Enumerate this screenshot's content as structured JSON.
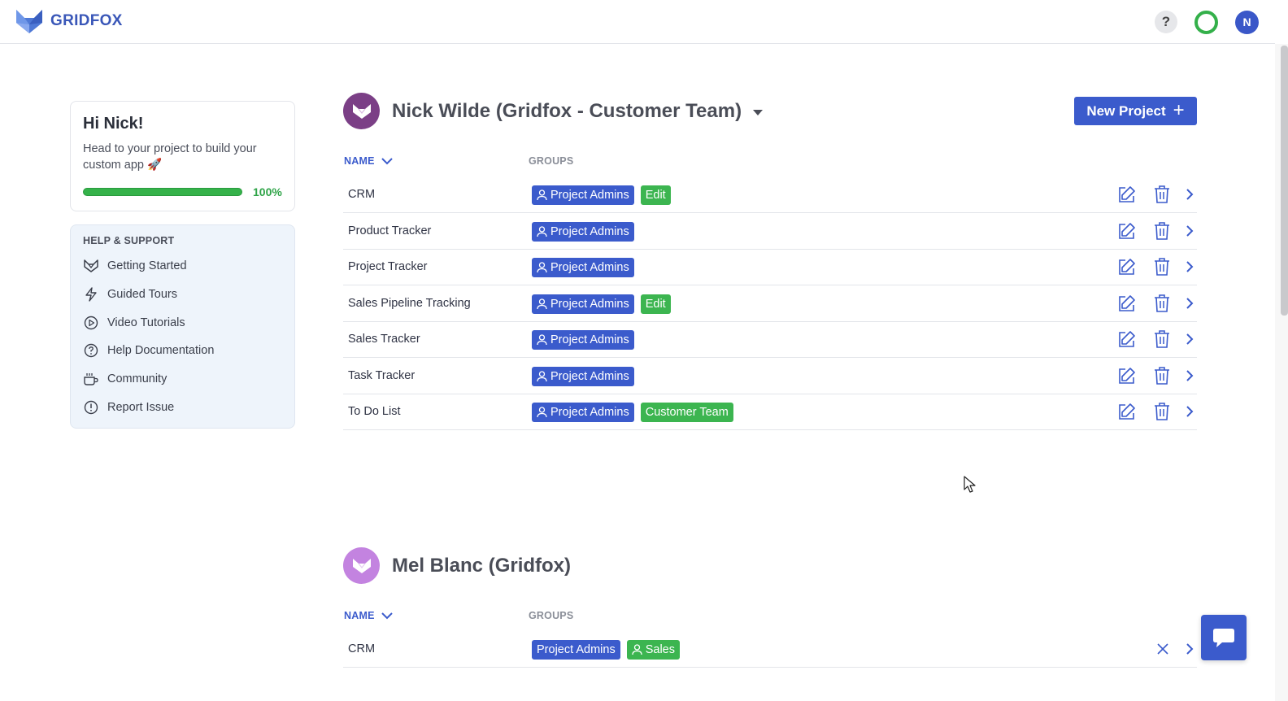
{
  "brand": {
    "name": "GRIDFOX"
  },
  "topbar": {
    "help_label": "?",
    "avatar_initial": "N"
  },
  "welcome": {
    "title": "Hi Nick!",
    "text": "Head to your project to build your custom app 🚀",
    "progress": 1.0,
    "progress_label": "100%"
  },
  "help": {
    "heading": "HELP & SUPPORT",
    "items": [
      {
        "label": "Getting Started",
        "icon": "fox-icon"
      },
      {
        "label": "Guided Tours",
        "icon": "lightning-icon"
      },
      {
        "label": "Video Tutorials",
        "icon": "play-circle-icon"
      },
      {
        "label": "Help Documentation",
        "icon": "question-circle-icon"
      },
      {
        "label": "Community",
        "icon": "coffee-cup-icon"
      },
      {
        "label": "Report Issue",
        "icon": "alert-circle-icon"
      }
    ]
  },
  "teams": [
    {
      "title": "Nick Wilde (Gridfox - Customer Team)",
      "logo_color": "#7b3f86",
      "new_project_label": "New Project",
      "columns": {
        "name": "NAME",
        "groups": "GROUPS"
      },
      "projects": [
        {
          "name": "CRM",
          "groups": [
            {
              "label": "Project Admins",
              "color": "blue",
              "person": true
            },
            {
              "label": "Edit",
              "color": "green",
              "person": false
            }
          ]
        },
        {
          "name": "Product Tracker",
          "groups": [
            {
              "label": "Project Admins",
              "color": "blue",
              "person": true
            }
          ]
        },
        {
          "name": "Project Tracker",
          "groups": [
            {
              "label": "Project Admins",
              "color": "blue",
              "person": true
            }
          ]
        },
        {
          "name": "Sales Pipeline Tracking",
          "groups": [
            {
              "label": "Project Admins",
              "color": "blue",
              "person": true
            },
            {
              "label": "Edit",
              "color": "green",
              "person": false
            }
          ]
        },
        {
          "name": "Sales Tracker",
          "groups": [
            {
              "label": "Project Admins",
              "color": "blue",
              "person": true
            }
          ]
        },
        {
          "name": "Task Tracker",
          "groups": [
            {
              "label": "Project Admins",
              "color": "blue",
              "person": true
            }
          ]
        },
        {
          "name": "To Do List",
          "groups": [
            {
              "label": "Project Admins",
              "color": "blue",
              "person": true
            },
            {
              "label": "Customer Team",
              "color": "green",
              "person": false
            }
          ]
        }
      ]
    },
    {
      "title": "Mel Blanc (Gridfox)",
      "logo_color": "#c383e0",
      "columns": {
        "name": "NAME",
        "groups": "GROUPS"
      },
      "projects": [
        {
          "name": "CRM",
          "groups": [
            {
              "label": "Project Admins",
              "color": "blue",
              "person": false
            },
            {
              "label": "Sales",
              "color": "green",
              "person": true
            }
          ]
        }
      ]
    }
  ],
  "colors": {
    "primary": "#3b5bcc",
    "green": "#3cb550",
    "progress": "#35b24a"
  }
}
